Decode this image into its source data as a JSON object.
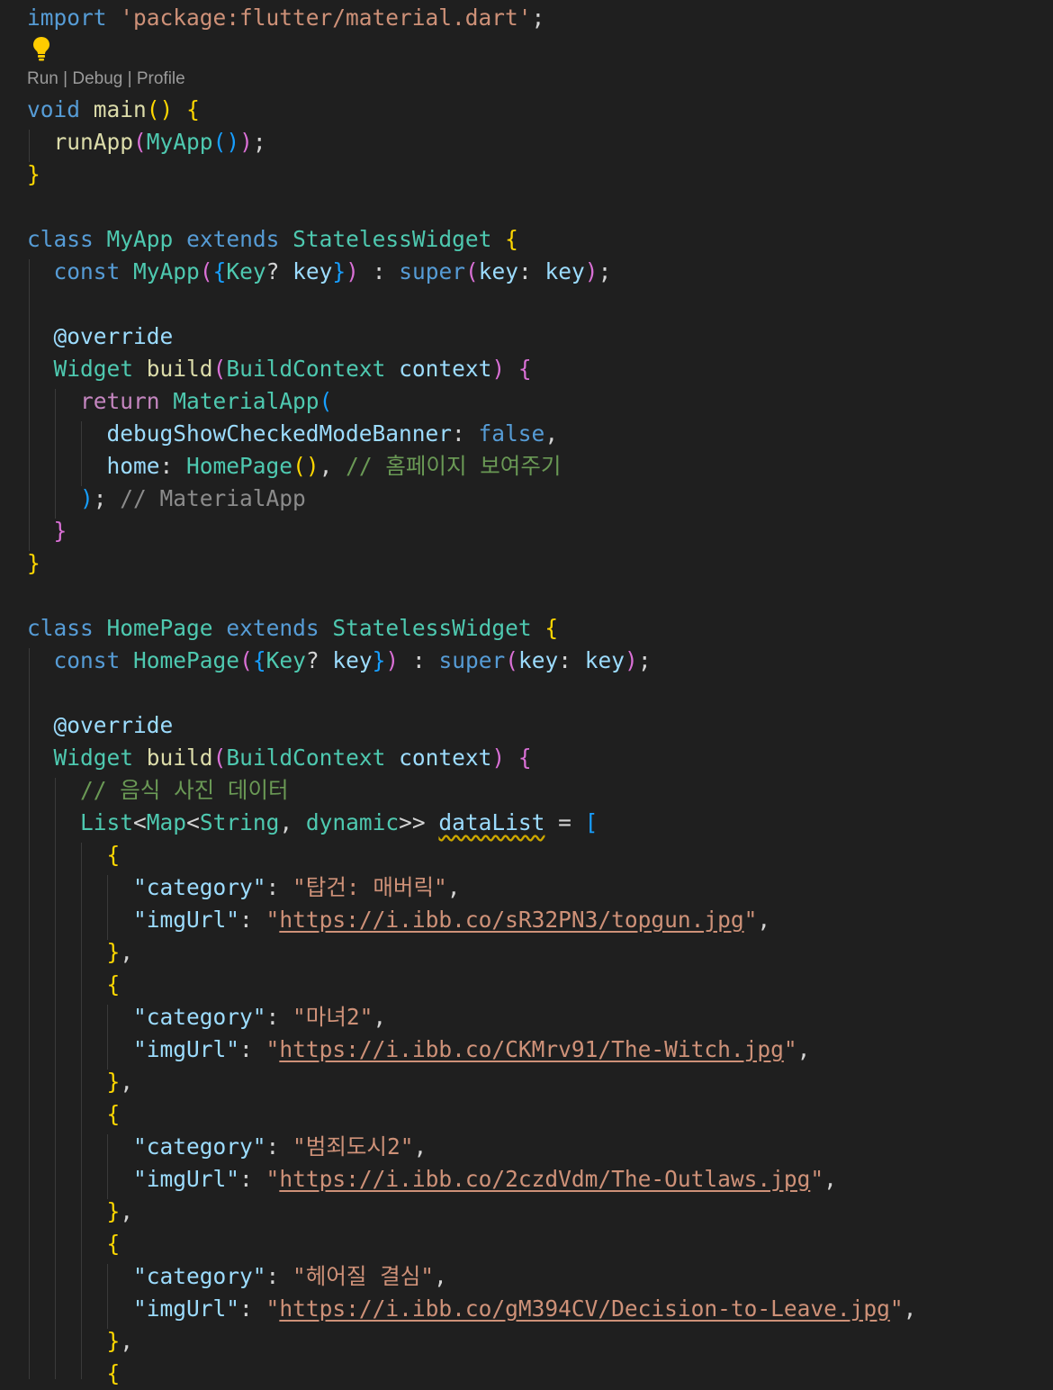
{
  "codelens": {
    "run": "Run",
    "debug": "Debug",
    "profile": "Profile",
    "sep": " | "
  },
  "icons": {
    "lightbulb": "lightbulb-icon"
  },
  "colors": {
    "background": "#1f1f1f",
    "keyword": "#569cd6",
    "string": "#ce9178",
    "type": "#4ec9b0",
    "comment": "#6a9955"
  },
  "code": {
    "import_kw": "import",
    "import_path": "'package:flutter/material.dart'",
    "void_kw": "void",
    "main_fn": "main",
    "runapp_fn": "runApp",
    "myapp": "MyApp",
    "homepage": "HomePage",
    "class_kw": "class",
    "extends_kw": "extends",
    "stateless": "StatelessWidget",
    "const_kw": "const",
    "key_type": "Key",
    "key": "key",
    "super_kw": "super",
    "override": "@override",
    "widget": "Widget",
    "build": "build",
    "buildcontext": "BuildContext",
    "context": "context",
    "return_kw": "return",
    "materialapp": "MaterialApp",
    "debug_banner": "debugShowCheckedModeBanner",
    "false_kw": "false",
    "home": "home",
    "home_comment": "// 홈페이지 보여주기",
    "materialapp_closing": "// MaterialApp",
    "data_comment": "// 음식 사진 데이터",
    "list_type": "List",
    "map_type": "Map",
    "string_type": "String",
    "dynamic_type": "dynamic",
    "datalist": "dataList",
    "category_key": "\"category\"",
    "imgurl_key": "\"imgUrl\"",
    "items": [
      {
        "category": "\"탑건: 매버릭\"",
        "url": "https://i.ibb.co/sR32PN3/topgun.jpg"
      },
      {
        "category": "\"마녀2\"",
        "url": "https://i.ibb.co/CKMrv91/The-Witch.jpg"
      },
      {
        "category": "\"범죄도시2\"",
        "url": "https://i.ibb.co/2czdVdm/The-Outlaws.jpg"
      },
      {
        "category": "\"헤어질 결심\"",
        "url": "https://i.ibb.co/gM394CV/Decision-to-Leave.jpg"
      }
    ]
  }
}
